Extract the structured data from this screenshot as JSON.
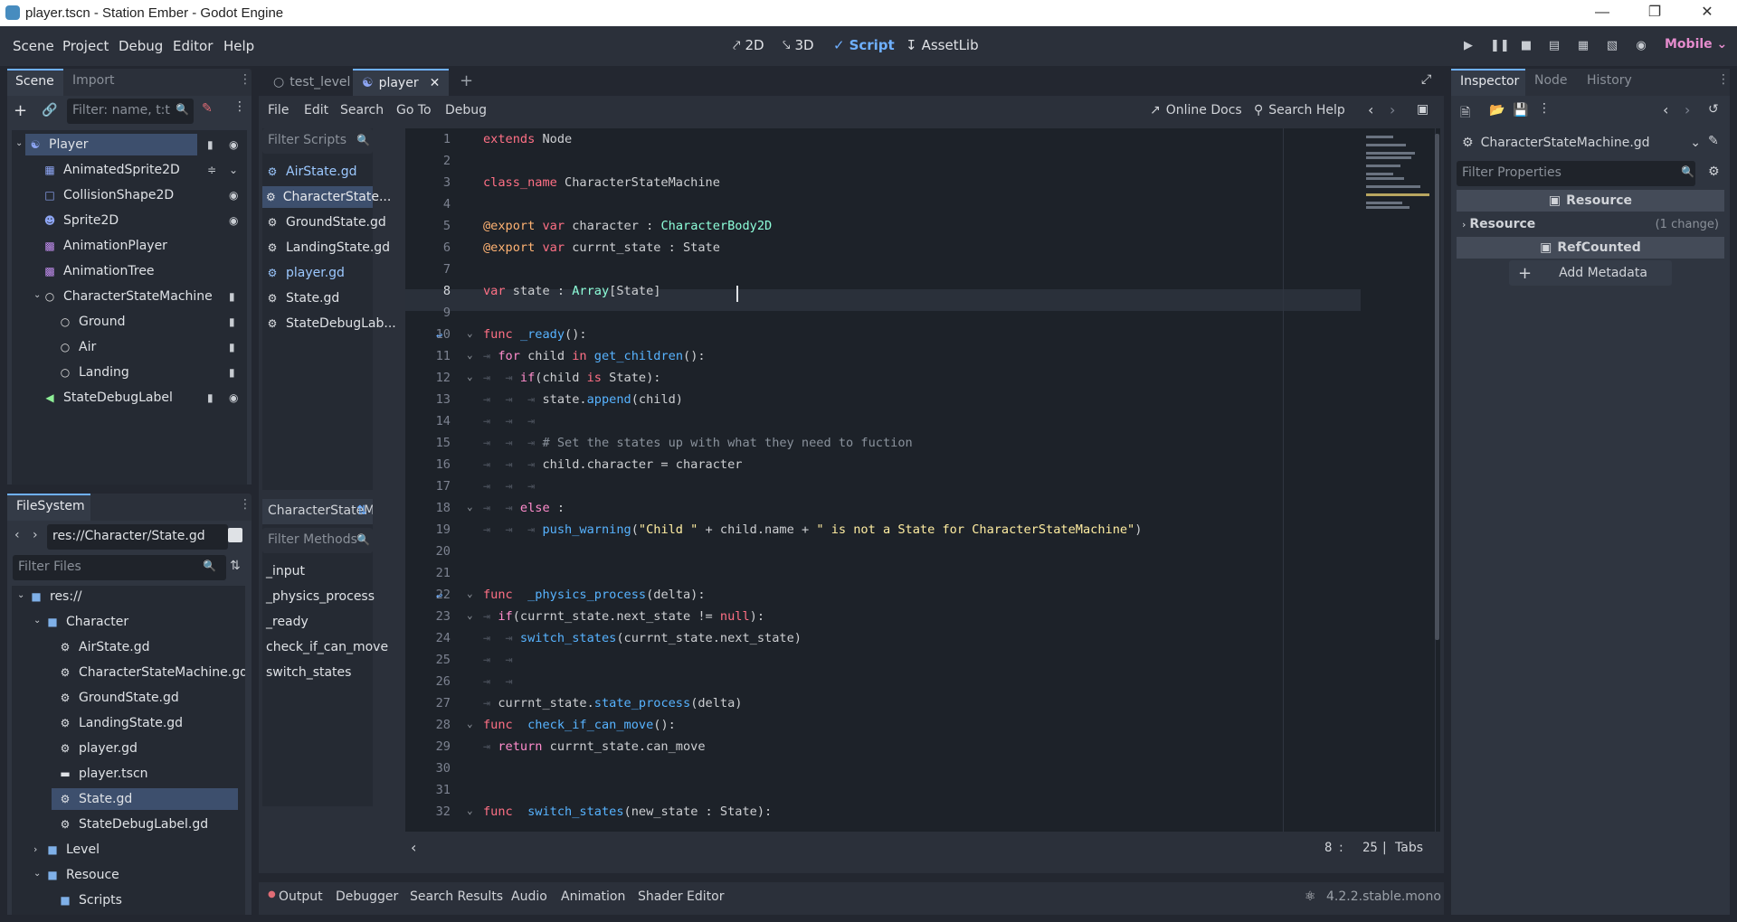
{
  "window": {
    "title": "player.tscn - Station Ember - Godot Engine"
  },
  "menu": {
    "items": [
      "Scene",
      "Project",
      "Debug",
      "Editor",
      "Help"
    ]
  },
  "workspaces": [
    {
      "label": "2D",
      "icon": "2d-icon"
    },
    {
      "label": "3D",
      "icon": "3d-icon"
    },
    {
      "label": "Script",
      "icon": "script-icon",
      "active": true
    },
    {
      "label": "AssetLib",
      "icon": "assetlib-icon"
    }
  ],
  "renderer": "Mobile",
  "scene_dock": {
    "tabs": [
      "Scene",
      "Import"
    ],
    "filter_placeholder": "Filter: name, t:t",
    "nodes": [
      {
        "name": "Player",
        "icon": "character-icon",
        "color": "#8da5f3",
        "depth": 0,
        "selected": true
      },
      {
        "name": "AnimatedSprite2D",
        "icon": "animated-sprite-icon",
        "color": "#8da5f3",
        "depth": 1
      },
      {
        "name": "CollisionShape2D",
        "icon": "collision-shape-icon",
        "color": "#8da5f3",
        "depth": 1
      },
      {
        "name": "Sprite2D",
        "icon": "sprite-icon",
        "color": "#8da5f3",
        "depth": 1
      },
      {
        "name": "AnimationPlayer",
        "icon": "animation-player-icon",
        "color": "#c38ef1",
        "depth": 1
      },
      {
        "name": "AnimationTree",
        "icon": "animation-tree-icon",
        "color": "#c38ef1",
        "depth": 1
      },
      {
        "name": "CharacterStateMachine",
        "icon": "node-icon",
        "color": "#e0e0e0",
        "depth": 1
      },
      {
        "name": "Ground",
        "icon": "node-icon",
        "color": "#e0e0e0",
        "depth": 2
      },
      {
        "name": "Air",
        "icon": "node-icon",
        "color": "#e0e0e0",
        "depth": 2
      },
      {
        "name": "Landing",
        "icon": "node-icon",
        "color": "#e0e0e0",
        "depth": 2
      },
      {
        "name": "StateDebugLabel",
        "icon": "label-icon",
        "color": "#8eef97",
        "depth": 1
      }
    ]
  },
  "filesystem": {
    "tab": "FileSystem",
    "path": "res://Character/State.gd",
    "filter_placeholder": "Filter Files",
    "items": [
      {
        "name": "res://",
        "type": "folder",
        "depth": 0
      },
      {
        "name": "Character",
        "type": "folder",
        "depth": 1
      },
      {
        "name": "AirState.gd",
        "type": "script",
        "depth": 2
      },
      {
        "name": "CharacterStateMachine.gd",
        "type": "script",
        "depth": 2
      },
      {
        "name": "GroundState.gd",
        "type": "script",
        "depth": 2
      },
      {
        "name": "LandingState.gd",
        "type": "script",
        "depth": 2
      },
      {
        "name": "player.gd",
        "type": "script",
        "depth": 2
      },
      {
        "name": "player.tscn",
        "type": "scene",
        "depth": 2
      },
      {
        "name": "State.gd",
        "type": "script",
        "depth": 2,
        "selected": true
      },
      {
        "name": "StateDebugLabel.gd",
        "type": "script",
        "depth": 2
      },
      {
        "name": "Level",
        "type": "folder",
        "depth": 1
      },
      {
        "name": "Resouce",
        "type": "folder",
        "depth": 1
      },
      {
        "name": "Scripts",
        "type": "folder",
        "depth": 2
      }
    ]
  },
  "scene_tabs": [
    {
      "label": "test_level",
      "active": false
    },
    {
      "label": "player",
      "active": true
    }
  ],
  "script_menu": {
    "items": [
      "File",
      "Edit",
      "Search",
      "Go To",
      "Debug"
    ],
    "online_docs": "Online Docs",
    "search_help": "Search Help"
  },
  "script_list": {
    "filter_placeholder": "Filter Scripts",
    "items": [
      {
        "name": "AirState.gd",
        "color": "#9cc8ff"
      },
      {
        "name": "CharacterState...",
        "color": "#e6e8ec",
        "selected": true
      },
      {
        "name": "GroundState.gd",
        "color": "#dfe2e6"
      },
      {
        "name": "LandingState.gd",
        "color": "#dfe2e6"
      },
      {
        "name": "player.gd",
        "color": "#9cc8ff"
      },
      {
        "name": "State.gd",
        "color": "#dfe2e6"
      },
      {
        "name": "StateDebugLab...",
        "color": "#dfe2e6"
      }
    ],
    "current": "CharacterStateM",
    "methods_filter": "Filter Methods",
    "methods": [
      "_input",
      "_physics_process",
      "_ready",
      "check_if_can_move",
      "switch_states"
    ]
  },
  "editor": {
    "line_numbers": [
      "1",
      "2",
      "3",
      "4",
      "5",
      "6",
      "7",
      "8",
      "9",
      "10",
      "11",
      "12",
      "13",
      "14",
      "15",
      "16",
      "17",
      "18",
      "19",
      "20",
      "21",
      "22",
      "23",
      "24",
      "25",
      "26",
      "27",
      "28",
      "29",
      "30",
      "31",
      "32"
    ],
    "status_line": "8",
    "status_col": "25",
    "status_indent": "Tabs"
  },
  "bottom_tabs": [
    "Output",
    "Debugger",
    "Search Results",
    "Audio",
    "Animation",
    "Shader Editor"
  ],
  "version": "4.2.2.stable.mono",
  "inspector": {
    "tabs": [
      "Inspector",
      "Node",
      "History"
    ],
    "resource_name": "CharacterStateMachine.gd",
    "filter_placeholder": "Filter Properties",
    "section_resource": "Resource",
    "prop_resource": "Resource",
    "prop_change": "(1 change)",
    "section_refcounted": "RefCounted",
    "add_metadata": "Add Metadata"
  }
}
